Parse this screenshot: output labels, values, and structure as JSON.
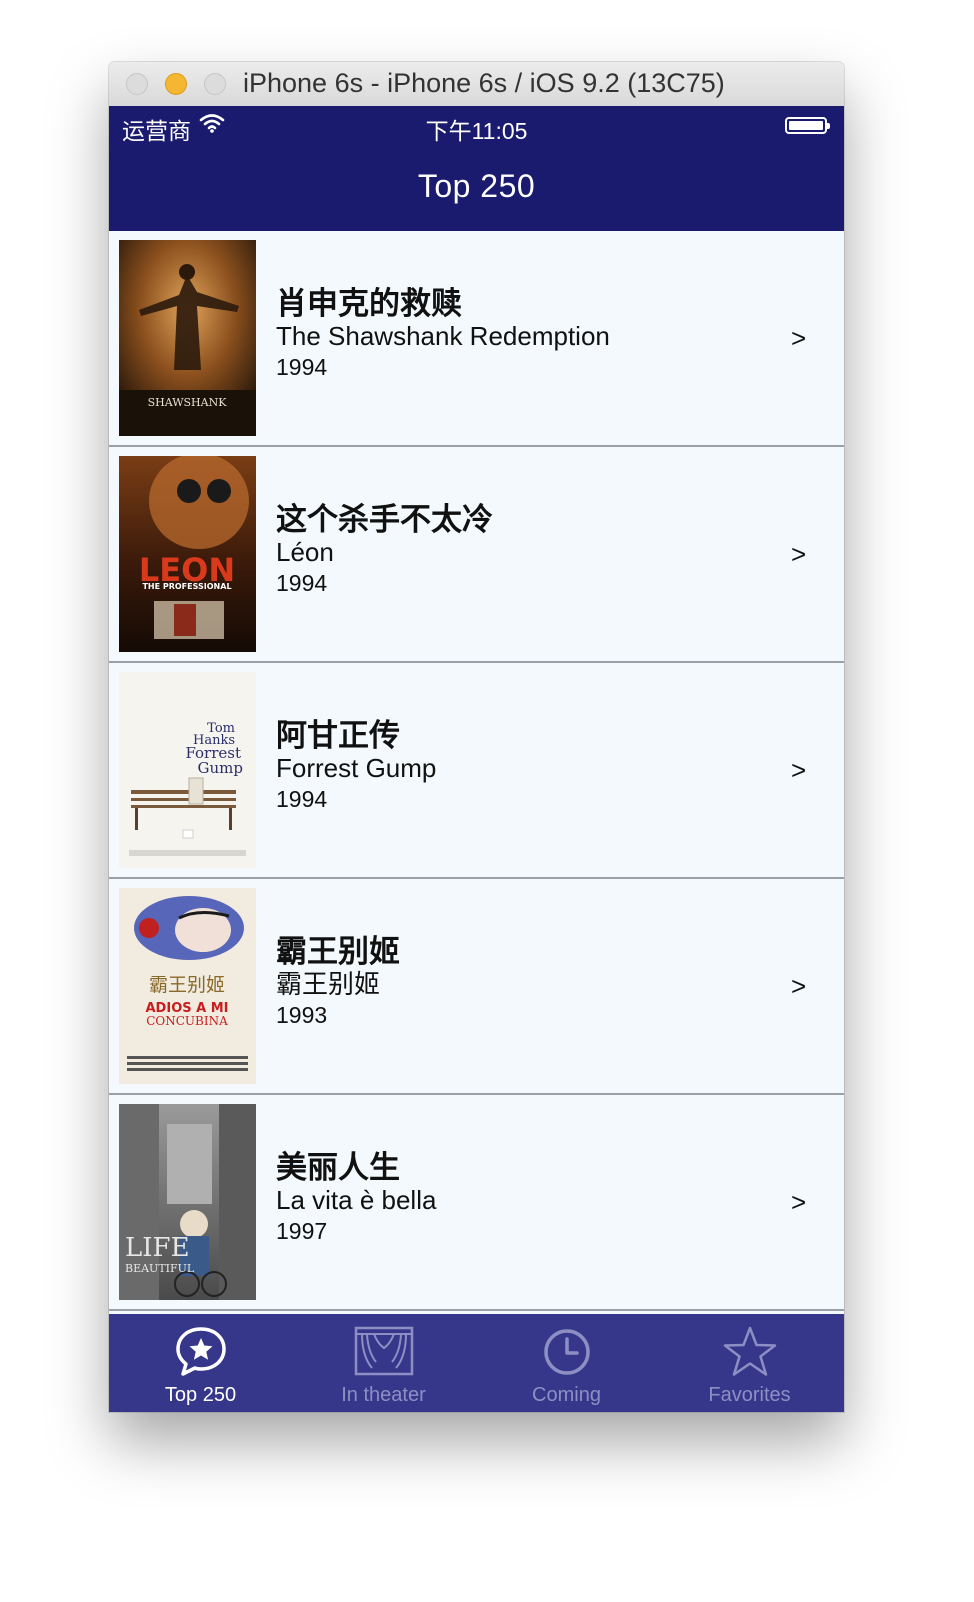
{
  "window": {
    "title": "iPhone 6s - iPhone 6s / iOS 9.2 (13C75)"
  },
  "status_bar": {
    "carrier": "运营商",
    "time": "下午11:05"
  },
  "nav": {
    "title": "Top 250"
  },
  "movies": [
    {
      "title_cn": "肖申克的救赎",
      "title_original": "The Shawshank Redemption",
      "year": "1994",
      "chevron": ">"
    },
    {
      "title_cn": "这个杀手不太冷",
      "title_original": "Léon",
      "year": "1994",
      "chevron": ">"
    },
    {
      "title_cn": "阿甘正传",
      "title_original": "Forrest Gump",
      "year": "1994",
      "chevron": ">"
    },
    {
      "title_cn": "霸王别姬",
      "title_original": "霸王别姬",
      "year": "1993",
      "chevron": ">"
    },
    {
      "title_cn": "美丽人生",
      "title_original": "La vita è bella",
      "year": "1997",
      "chevron": ">"
    }
  ],
  "poster_text": {
    "shawshank": "SHAWSHANK",
    "leon": "LEON",
    "leon_sub": "THE PROFESSIONAL",
    "forrest_1": "Tom",
    "forrest_2": "Hanks",
    "forrest_3": "Forrest",
    "forrest_4": "Gump",
    "concubine_cn": "霸王别姬",
    "concubine_1": "ADIOS A MI",
    "concubine_2": "CONCUBINA",
    "life_1": "LIFE",
    "life_2": "BEAUTIFUL"
  },
  "tabs": [
    {
      "label": "Top 250",
      "icon": "star-bubble-icon",
      "active": true
    },
    {
      "label": "In theater",
      "icon": "theater-curtain-icon",
      "active": false
    },
    {
      "label": "Coming",
      "icon": "clock-icon",
      "active": false
    },
    {
      "label": "Favorites",
      "icon": "star-icon",
      "active": false
    }
  ],
  "colors": {
    "nav_background": "#1a1a6e",
    "tab_background": "#36378a",
    "row_background": "#f3f9fd",
    "tab_active": "#ffffff",
    "tab_inactive": "#8d8fc4"
  }
}
